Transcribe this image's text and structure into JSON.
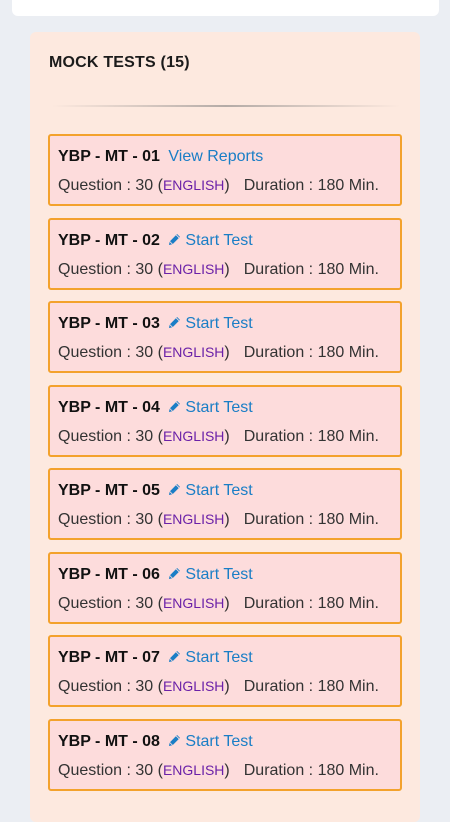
{
  "header": {
    "title": "MOCK TESTS (15)"
  },
  "tests": [
    {
      "code": "YBP - MT - 01",
      "action": "View Reports",
      "has_pencil": false,
      "question_label": "Question : 30 (",
      "lang": "ENGLISH",
      "close": ")",
      "duration": "Duration : 180 Min."
    },
    {
      "code": "YBP - MT - 02",
      "action": "Start Test",
      "has_pencil": true,
      "question_label": "Question : 30 (",
      "lang": "ENGLISH",
      "close": ")",
      "duration": "Duration : 180 Min."
    },
    {
      "code": "YBP - MT - 03",
      "action": "Start Test",
      "has_pencil": true,
      "question_label": "Question : 30 (",
      "lang": "ENGLISH",
      "close": ")",
      "duration": "Duration : 180 Min."
    },
    {
      "code": "YBP - MT - 04",
      "action": "Start Test",
      "has_pencil": true,
      "question_label": "Question : 30 (",
      "lang": "ENGLISH",
      "close": ")",
      "duration": "Duration : 180 Min."
    },
    {
      "code": "YBP - MT - 05",
      "action": "Start Test",
      "has_pencil": true,
      "question_label": "Question : 30 (",
      "lang": "ENGLISH",
      "close": ")",
      "duration": "Duration : 180 Min."
    },
    {
      "code": "YBP - MT - 06",
      "action": "Start Test",
      "has_pencil": true,
      "question_label": "Question : 30 (",
      "lang": "ENGLISH",
      "close": ")",
      "duration": "Duration : 180 Min."
    },
    {
      "code": "YBP - MT - 07",
      "action": "Start Test",
      "has_pencil": true,
      "question_label": "Question : 30 (",
      "lang": "ENGLISH",
      "close": ")",
      "duration": "Duration : 180 Min."
    },
    {
      "code": "YBP - MT - 08",
      "action": "Start Test",
      "has_pencil": true,
      "question_label": "Question : 30 (",
      "lang": "ENGLISH",
      "close": ")",
      "duration": "Duration : 180 Min."
    }
  ],
  "colors": {
    "panel_bg": "#fde9df",
    "card_bg": "#fddcdc",
    "card_border": "#f3a22c",
    "link": "#1a7ec6",
    "lang": "#6b21a8"
  },
  "icons": {
    "start_test": "pencil-icon"
  }
}
